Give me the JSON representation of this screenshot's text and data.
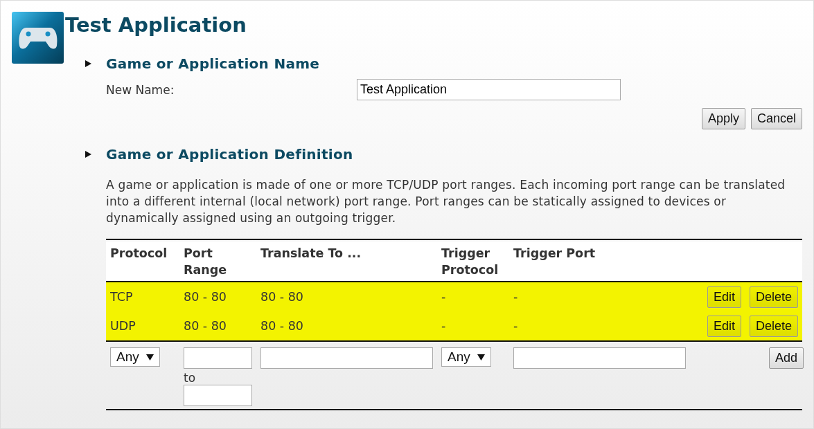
{
  "title": "Test Application",
  "name_section": {
    "heading": "Game or Application Name",
    "label": "New Name:",
    "value": "Test Application",
    "buttons": [
      "Apply",
      "Cancel"
    ]
  },
  "definition_section": {
    "heading": "Game or Application Definition",
    "description": "A game or application is made of one or more TCP/UDP port ranges. Each incoming port range can be translated into a different internal (local network) port range. Port ranges can be statically assigned to devices or dynamically assigned using an outgoing trigger.",
    "table": {
      "columns": [
        "Protocol",
        "Port Range",
        "Translate To ...",
        "Trigger Protocol",
        "Trigger Port"
      ],
      "rows": [
        {
          "protocol": "TCP",
          "port_range": "80 - 80",
          "translate_to": "80 - 80",
          "trigger_protocol": "-",
          "trigger_port": "-",
          "highlighted": true,
          "edit": "Edit",
          "delete": "Delete"
        },
        {
          "protocol": "UDP",
          "port_range": "80 - 80",
          "translate_to": "80 - 80",
          "trigger_protocol": "-",
          "trigger_port": "-",
          "highlighted": true,
          "edit": "Edit",
          "delete": "Delete"
        }
      ],
      "new_row": {
        "protocol": "Any",
        "range_separator": "to",
        "trigger_protocol": "Any",
        "add": "Add"
      }
    }
  }
}
